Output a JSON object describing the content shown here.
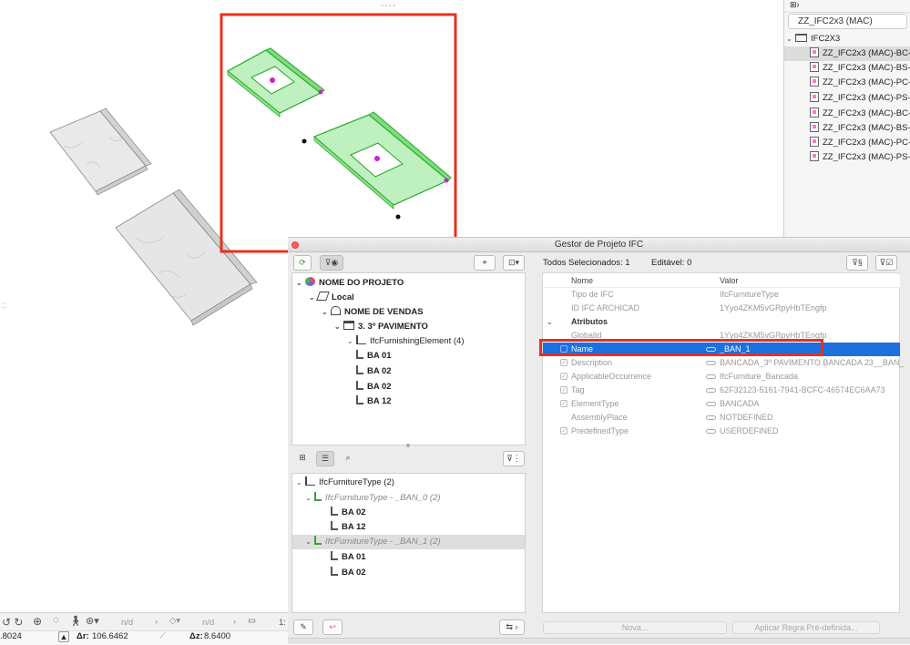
{
  "viewport": {
    "top_marker": "----",
    "left_marker": "::"
  },
  "browser": {
    "field_value": "ZZ_IFC2x3 (MAC)",
    "folder": "IFC2X3",
    "items": [
      "ZZ_IFC2x3 (MAC)-BC-TE",
      "ZZ_IFC2x3 (MAC)-BS-TE",
      "ZZ_IFC2x3 (MAC)-PC-TE",
      "ZZ_IFC2x3 (MAC)-PS-TE",
      "ZZ_IFC2x3 (MAC)-BC-Pe",
      "ZZ_IFC2x3 (MAC)-BS-Pe",
      "ZZ_IFC2x3 (MAC)-PC-Pe",
      "ZZ_IFC2x3 (MAC)-PS-Pe"
    ]
  },
  "dialog": {
    "title": "Gestor de Projeto IFC",
    "selected_count": "Todos Selecionados: 1",
    "editable_count": "Editável: 0",
    "spatial_tree": [
      {
        "label": "NOME DO PROJETO",
        "icon": "project-icon"
      },
      {
        "label": "Local",
        "icon": "site-icon"
      },
      {
        "label": "NOME DE VENDAS",
        "icon": "building-icon"
      },
      {
        "label": "3. 3º PAVIMENTO",
        "icon": "story-icon"
      },
      {
        "label": "IfcFurnishingElement (4)",
        "icon": "type-icon"
      },
      {
        "label": "BA 01",
        "icon": "furniture-icon"
      },
      {
        "label": "BA 02",
        "icon": "furniture-icon"
      },
      {
        "label": "BA 02",
        "icon": "furniture-icon"
      },
      {
        "label": "BA 12",
        "icon": "furniture-icon"
      }
    ],
    "type_tree": [
      {
        "label": "IfcFurnitureType (2)"
      },
      {
        "label": "IfcFurnitureType - _BAN_0 (2)"
      },
      {
        "label": "BA 02"
      },
      {
        "label": "BA 12"
      },
      {
        "label": "IfcFurnitureType - _BAN_1 (2)"
      },
      {
        "label": "BA 01"
      },
      {
        "label": "BA 02"
      }
    ],
    "columns": {
      "name": "Nome",
      "value": "Valor"
    },
    "properties": [
      {
        "name": "Tipo de IFC",
        "value": "IfcFurnitureType"
      },
      {
        "name": "ID IFC ARCHICAD",
        "value": "1Yyo4ZKM5vGRpyHbTEngfp"
      }
    ],
    "group_label": "Atributos",
    "attributes": [
      {
        "name": "GlobalId",
        "value": "1Yyo4ZKM5vGRpyHbTEngfp"
      },
      {
        "name": "Name",
        "value": "_BAN_1"
      },
      {
        "name": "Description",
        "value": "BANCADA_3º PAVIMENTO BANCADA 23__BAN_"
      },
      {
        "name": "ApplicableOccurrence",
        "value": "IfcFurniture_Bancada"
      },
      {
        "name": "Tag",
        "value": "62F32123-5161-7941-BCFC-46574EC6AA73"
      },
      {
        "name": "ElementType",
        "value": "BANCADA"
      },
      {
        "name": "AssemblyPlace",
        "value": "NOTDEFINED"
      },
      {
        "name": "PredefinedType",
        "value": "USERDEFINED"
      }
    ],
    "new_button": "Nova...",
    "apply_button": "Aplicar Regra Pré-definida..."
  },
  "statusbar": {
    "nd1": "n/d",
    "nd2": "n/d",
    "x_value": ".8024",
    "dr_label": "Δr:",
    "dr_value": "106.6462",
    "dz_label": "Δz:",
    "dz_value": "8.6400",
    "scale": "1:"
  },
  "colors": {
    "selection_blue": "#1e6fe0",
    "highlight_red": "#e8301c",
    "object_green": "#33cc33",
    "grip_magenta": "#cc22cc"
  }
}
